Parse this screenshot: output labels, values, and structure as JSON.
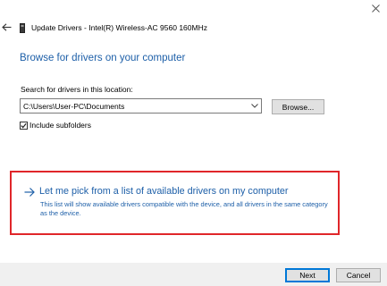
{
  "window": {
    "title": "Update Drivers - Intel(R) Wireless-AC 9560 160MHz",
    "close_icon": "close-icon",
    "back_icon": "back-arrow-icon",
    "device_icon": "device-icon"
  },
  "main": {
    "heading": "Browse for drivers on your computer",
    "search_label": "Search for drivers in this location:",
    "path_value": "C:\\Users\\User-PC\\Documents",
    "browse_label": "Browse...",
    "include_subfolders_label": "Include subfolders",
    "include_subfolders_checked": true
  },
  "pick_option": {
    "title": "Let me pick from a list of available drivers on my computer",
    "description": "This list will show available drivers compatible with the device, and all drivers in the same category as the device.",
    "highlight_color": "#e0262a",
    "link_color": "#1d5fa8"
  },
  "footer": {
    "next_label": "Next",
    "cancel_label": "Cancel"
  }
}
